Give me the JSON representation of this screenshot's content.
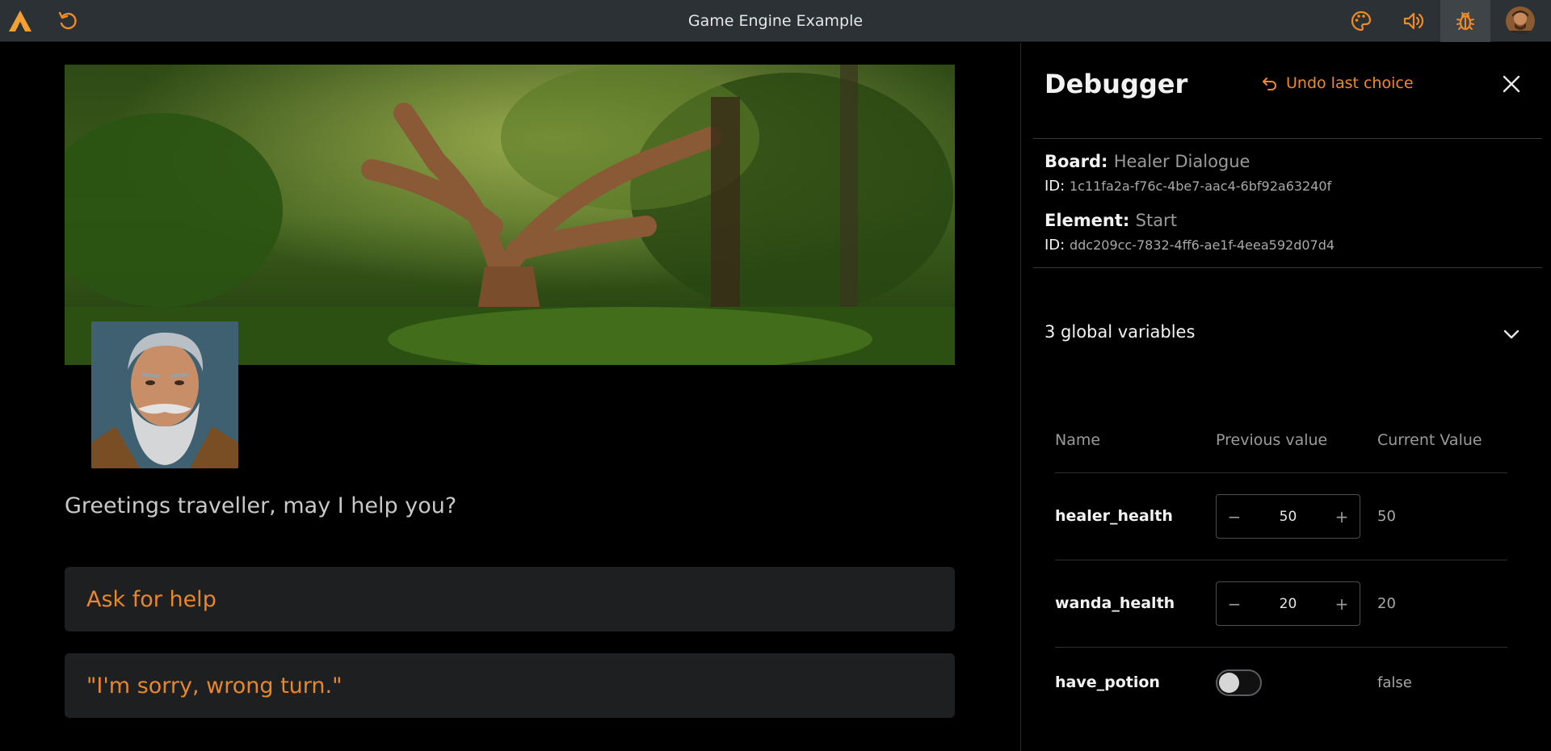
{
  "app": {
    "title": "Game Engine Example"
  },
  "topbar": {
    "icons": [
      "logo-icon",
      "reload-icon",
      "palette-icon",
      "volume-icon",
      "bug-icon",
      "user-avatar"
    ]
  },
  "game": {
    "dialogue": "Greetings traveller, may I help you?",
    "choices": [
      "Ask for help",
      "\"I'm sorry, wrong turn.\""
    ]
  },
  "debugger": {
    "title": "Debugger",
    "undo_label": "Undo last choice",
    "board_label": "Board:",
    "board_value": "Healer Dialogue",
    "board_id_label": "ID:",
    "board_id": "1c11fa2a-f76c-4be7-aac4-6bf92a63240f",
    "element_label": "Element:",
    "element_value": "Start",
    "element_id_label": "ID:",
    "element_id": "ddc209cc-7832-4ff6-ae1f-4eea592d07d4",
    "globals_label": "3 global variables",
    "columns": [
      "Name",
      "Previous value",
      "Current Value"
    ],
    "variables": [
      {
        "name": "healer_health",
        "previous": "50",
        "current": "50"
      },
      {
        "name": "wanda_health",
        "previous": "20",
        "current": "20"
      },
      {
        "name": "have_potion",
        "previous": "false",
        "current": "false"
      }
    ]
  },
  "colors": {
    "accent": "#f08a24",
    "topbar_bg": "#2b3134",
    "choice_bg": "#1d1f21"
  }
}
